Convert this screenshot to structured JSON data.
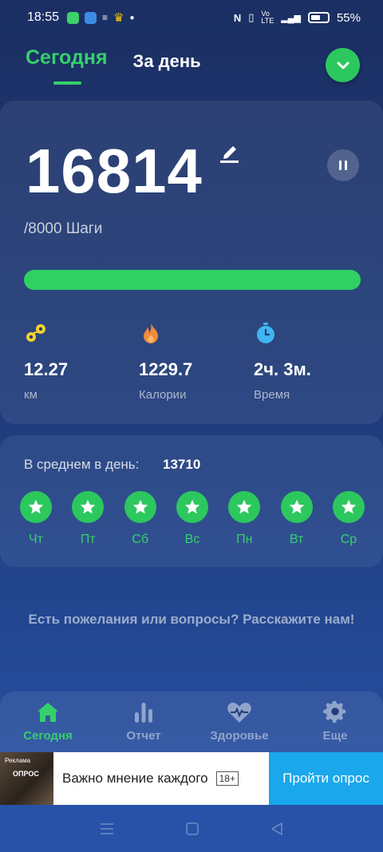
{
  "status_bar": {
    "time": "18:55",
    "battery": "55%"
  },
  "tabs": [
    {
      "label": "Сегодня",
      "active": true
    },
    {
      "label": "За день",
      "active": false
    }
  ],
  "steps": {
    "count": "16814",
    "goal": "/8000 Шаги",
    "progress_fraction": 1.0
  },
  "stats": [
    {
      "icon": "distance-icon",
      "value": "12.27",
      "label": "км",
      "color": "#f5d32a"
    },
    {
      "icon": "fire-icon",
      "value": "1229.7",
      "label": "Калории",
      "color": "#f08a3c"
    },
    {
      "icon": "stopwatch-icon",
      "value": "2ч. 3м.",
      "label": "Время",
      "color": "#3fb6f0"
    }
  ],
  "average": {
    "label": "В среднем в день:",
    "value": "13710"
  },
  "days": [
    "Чт",
    "Пт",
    "Сб",
    "Вс",
    "Пн",
    "Вт",
    "Ср"
  ],
  "feedback": "Есть пожелания или вопросы? Расскажите нам!",
  "bottom_nav": [
    {
      "icon": "home-icon",
      "label": "Сегодня",
      "active": true
    },
    {
      "icon": "bar-chart-icon",
      "label": "Отчет",
      "active": false
    },
    {
      "icon": "heart-pulse-icon",
      "label": "Здоровье",
      "active": false
    },
    {
      "icon": "gear-icon",
      "label": "Еще",
      "active": false
    }
  ],
  "ad": {
    "tag": "Реклама",
    "thumb_text": "ОПРОС",
    "text": "Важно мнение каждого",
    "age": "18+",
    "button": "Пройти опрос"
  },
  "colors": {
    "accent": "#35d06b",
    "background": "#1e3a78",
    "ad_button": "#1aa7ec"
  }
}
